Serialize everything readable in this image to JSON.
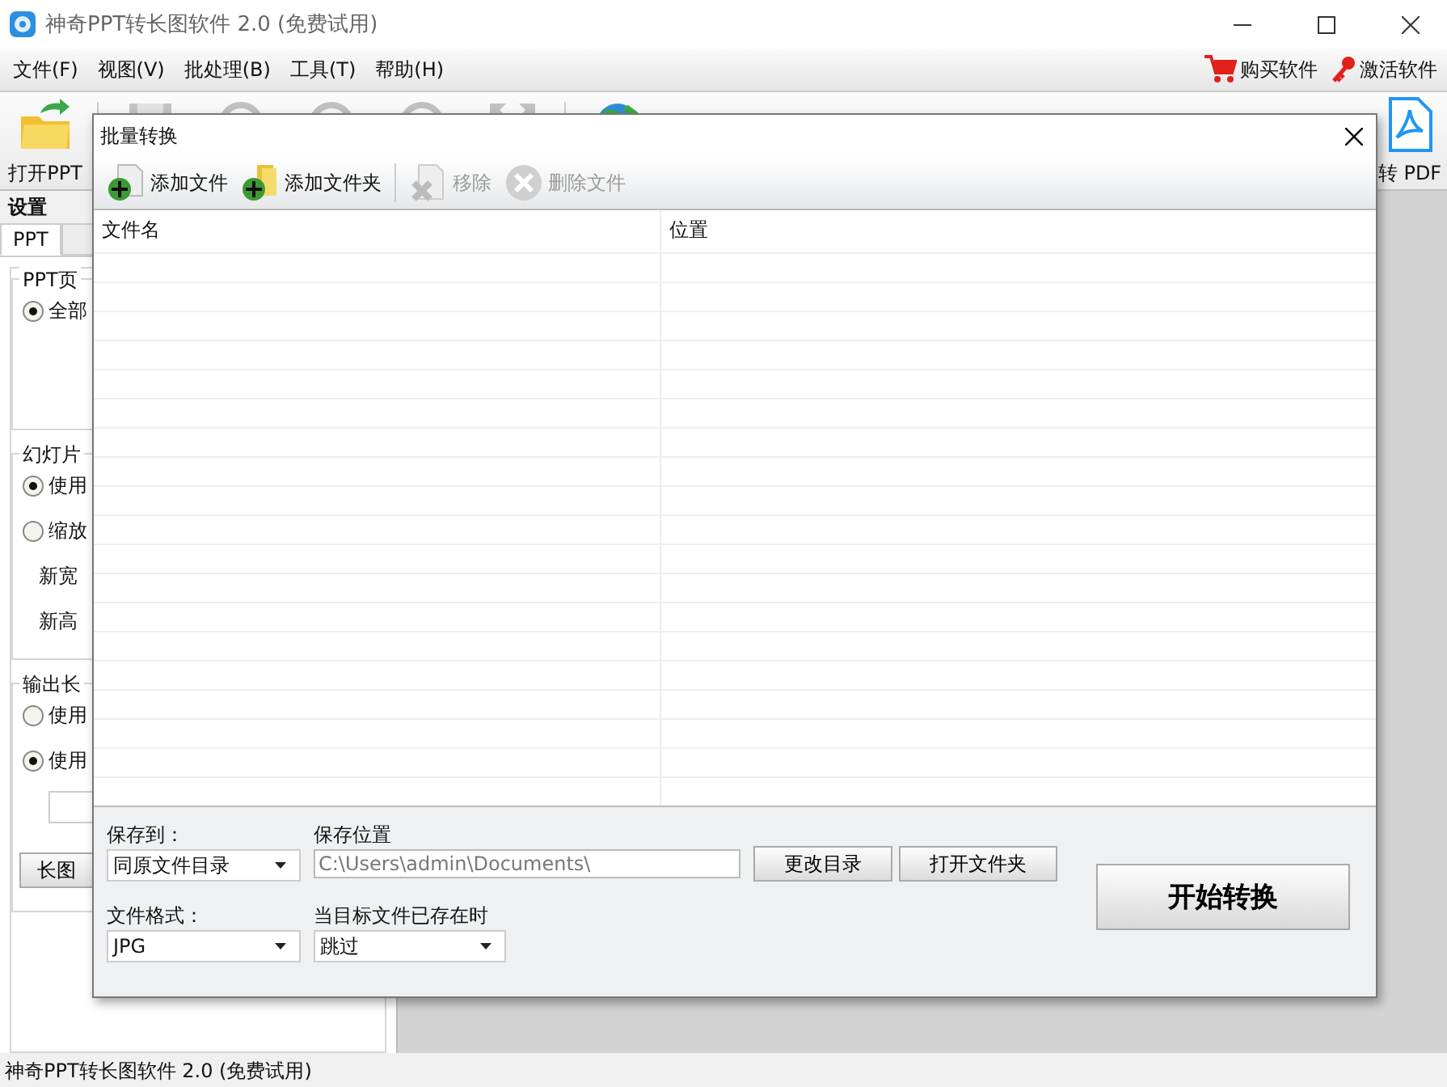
{
  "window": {
    "title": "神奇PPT转长图软件 2.0 (免费试用)"
  },
  "menu": [
    {
      "label": "文件(F)"
    },
    {
      "label": "视图(V)"
    },
    {
      "label": "批处理(B)"
    },
    {
      "label": "工具(T)"
    },
    {
      "label": "帮助(H)"
    }
  ],
  "menu_actions": [
    {
      "kind": "cart",
      "label": "购买软件"
    },
    {
      "kind": "key",
      "label": "激活软件"
    }
  ],
  "toolbar": [
    {
      "kind": "open",
      "label": "打开PPT"
    },
    {
      "kind": "save"
    },
    {
      "kind": "circle"
    },
    {
      "kind": "circle"
    },
    {
      "kind": "circle"
    },
    {
      "kind": "expand"
    },
    {
      "kind": "globe"
    },
    {
      "kind": "pdf",
      "label": "转 PDF"
    }
  ],
  "settings": {
    "title": "设置",
    "tabs": [
      {
        "label": "PPT",
        "selected": true
      },
      {
        "selected": false
      }
    ],
    "groups": [
      {
        "title": "PPT页",
        "options": [
          {
            "kind": "radio",
            "label": "全部",
            "checked": true
          }
        ]
      },
      {
        "title": "幻灯片",
        "options": [
          {
            "kind": "radio",
            "label": "使用",
            "checked": true
          },
          {
            "kind": "radio",
            "label": "缩放",
            "checked": false
          },
          {
            "kind": "text",
            "label": "新宽"
          },
          {
            "kind": "text",
            "label": "新高"
          }
        ]
      },
      {
        "title": "输出长",
        "options": [
          {
            "kind": "radio",
            "label": "使用",
            "checked": false
          },
          {
            "kind": "radio",
            "label": "使用",
            "checked": true
          },
          {
            "kind": "field"
          },
          {
            "kind": "button",
            "label": "长图"
          }
        ]
      }
    ]
  },
  "dialog": {
    "title": "批量转换",
    "toolbar": [
      {
        "kind": "add-file",
        "label": "添加文件",
        "disabled": false
      },
      {
        "kind": "add-folder",
        "label": "添加文件夹",
        "disabled": false
      },
      {
        "kind": "remove",
        "label": "移除",
        "disabled": true
      },
      {
        "kind": "delete",
        "label": "删除文件",
        "disabled": true
      }
    ],
    "table": {
      "columns": [
        "文件名",
        "位置"
      ]
    },
    "save_to": {
      "label": "保存到：",
      "value": "同原文件目录"
    },
    "save_location": {
      "label": "保存位置",
      "value": "C:\\Users\\admin\\Documents\\"
    },
    "buttons": [
      "更改目录",
      "打开文件夹"
    ],
    "format": {
      "label": "文件格式：",
      "value": "JPG"
    },
    "if_exists": {
      "label": "当目标文件已存在时",
      "value": "跳过"
    },
    "start_button": "开始转换"
  },
  "status_bar": "神奇PPT转长图软件 2.0 (免费试用)"
}
